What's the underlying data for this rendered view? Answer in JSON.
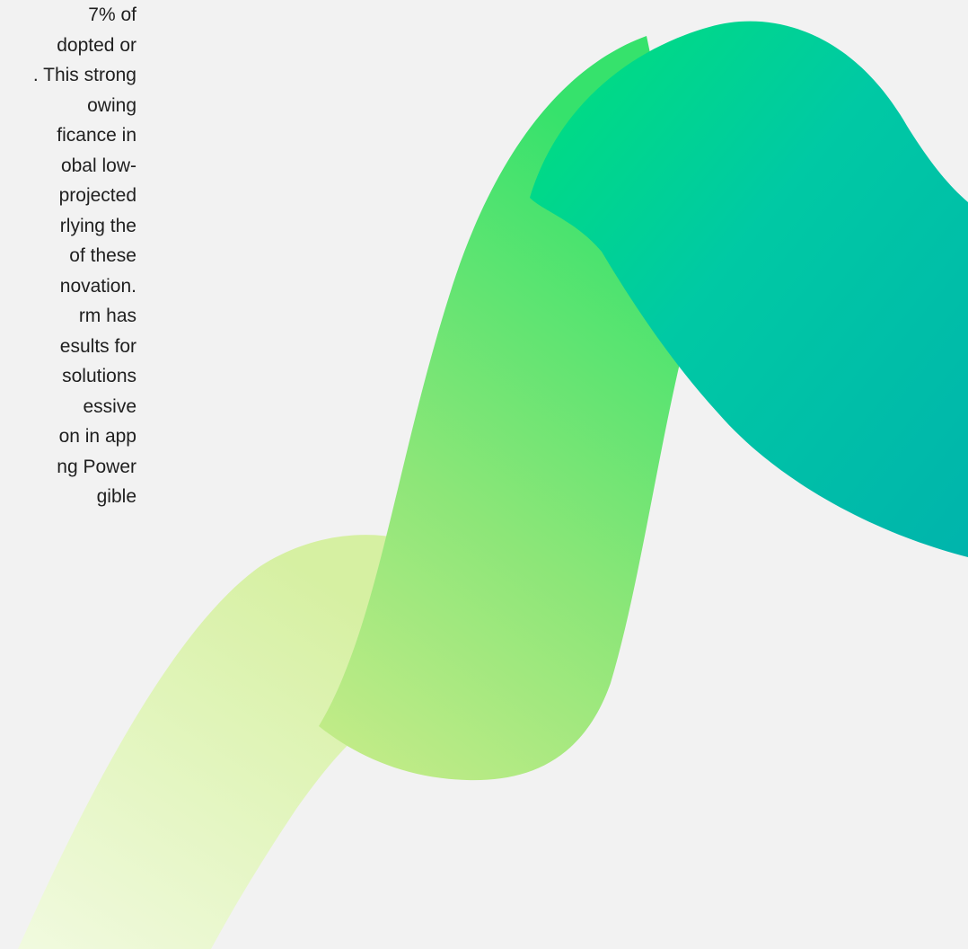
{
  "body_text_lines": [
    "7% of",
    "dopted or",
    ". This strong",
    "owing",
    "ficance in",
    "obal low-",
    "projected",
    "rlying the",
    "of these",
    "novation.",
    "rm has",
    "esults for",
    "solutions",
    "essive",
    "on in app",
    "ng Power",
    "gible"
  ],
  "colors": {
    "background": "#f2f2f2",
    "text": "#1f1f1f",
    "ribbon_light": "#e6f7c4",
    "ribbon_lime": "#c9ec8a",
    "ribbon_green": "#3fe46e",
    "ribbon_bright": "#00e176",
    "ribbon_teal": "#00b8ae"
  }
}
